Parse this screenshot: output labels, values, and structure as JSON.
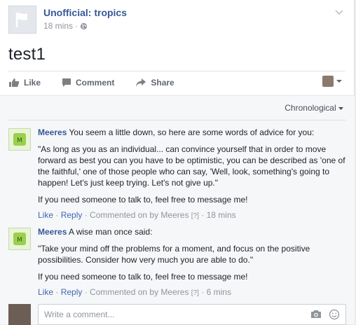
{
  "post": {
    "page_name": "Unofficial: tropics",
    "time": "18 mins",
    "meta_sep": "·",
    "text": "test1"
  },
  "actions": {
    "like": "Like",
    "comment": "Comment",
    "share": "Share"
  },
  "comments_section": {
    "sort_label": "Chronological",
    "comments": [
      {
        "author": "Meeres",
        "lead": "You seem a little down, so here are some words of advice for you:",
        "quote": "\"As long as you as an individual... can convince yourself that in order to move forward as best you can you have to be optimistic, you can be described as 'one of the faithful,' one of those people who can say, 'Well, look, something's going to happen! Let's just keep trying. Let's not give up.\"",
        "closing": "If you need someone to talk to, feel free to message me!",
        "like": "Like",
        "reply": "Reply",
        "commented_on_by": "Commented on by Meeres",
        "help": "[?]",
        "time": "18 mins"
      },
      {
        "author": "Meeres",
        "lead": "A wise man once said:",
        "quote": "\"Take your mind off the problems for a moment, and focus on the positive possibilities. Consider how very much you are able to do.\"",
        "closing": "If you need someone to talk to, feel free to message me!",
        "like": "Like",
        "reply": "Reply",
        "commented_on_by": "Commented on by Meeres",
        "help": "[?]",
        "time": "6 mins"
      }
    ],
    "write_placeholder": "Write a comment..."
  },
  "colors": {
    "link": "#365899",
    "muted": "#90949c",
    "bg": "#f6f7f9"
  }
}
